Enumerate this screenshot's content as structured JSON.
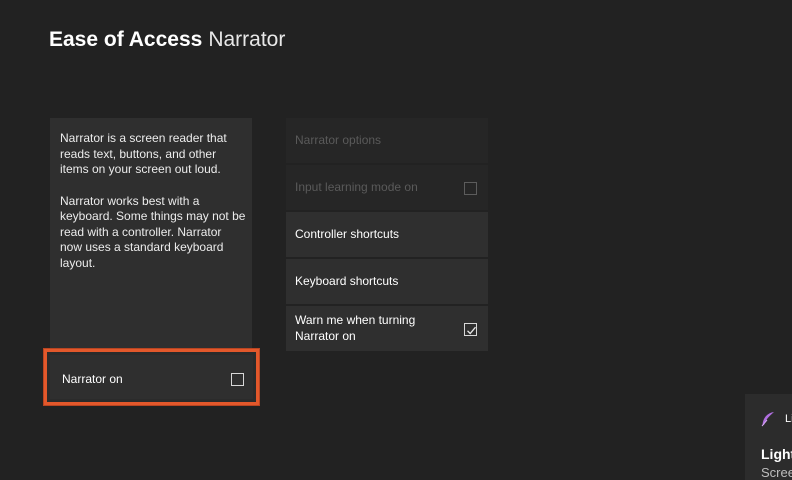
{
  "header": {
    "section": "Ease of Access",
    "page": "Narrator"
  },
  "description": {
    "paragraph1": "Narrator is a screen reader that reads text, buttons, and other items on your screen out loud.",
    "paragraph2": "Narrator works best with a keyboard. Some things may not be read with a controller. Narrator now uses a standard keyboard layout."
  },
  "narrator_toggle": {
    "label": "Narrator on",
    "checked": false,
    "focused": true,
    "focus_color": "#e3582b"
  },
  "options": [
    {
      "label": "Narrator options",
      "enabled": false
    },
    {
      "label": "Input learning mode on",
      "enabled": false,
      "checkbox": true,
      "checked": false
    },
    {
      "label": "Controller shortcuts",
      "enabled": true
    },
    {
      "label": "Keyboard shortcuts",
      "enabled": true
    },
    {
      "label": "Warn me when turning Narrator on",
      "enabled": true,
      "checkbox": true,
      "checked": true
    }
  ],
  "toast": {
    "icon": "feather-icon",
    "icon_color": "#b06fe0",
    "app_name": "Li",
    "title": "Light",
    "subtitle": "Scree"
  },
  "colors": {
    "background": "#222222",
    "panel": "#2f2f2f",
    "focus": "#e3582b"
  }
}
